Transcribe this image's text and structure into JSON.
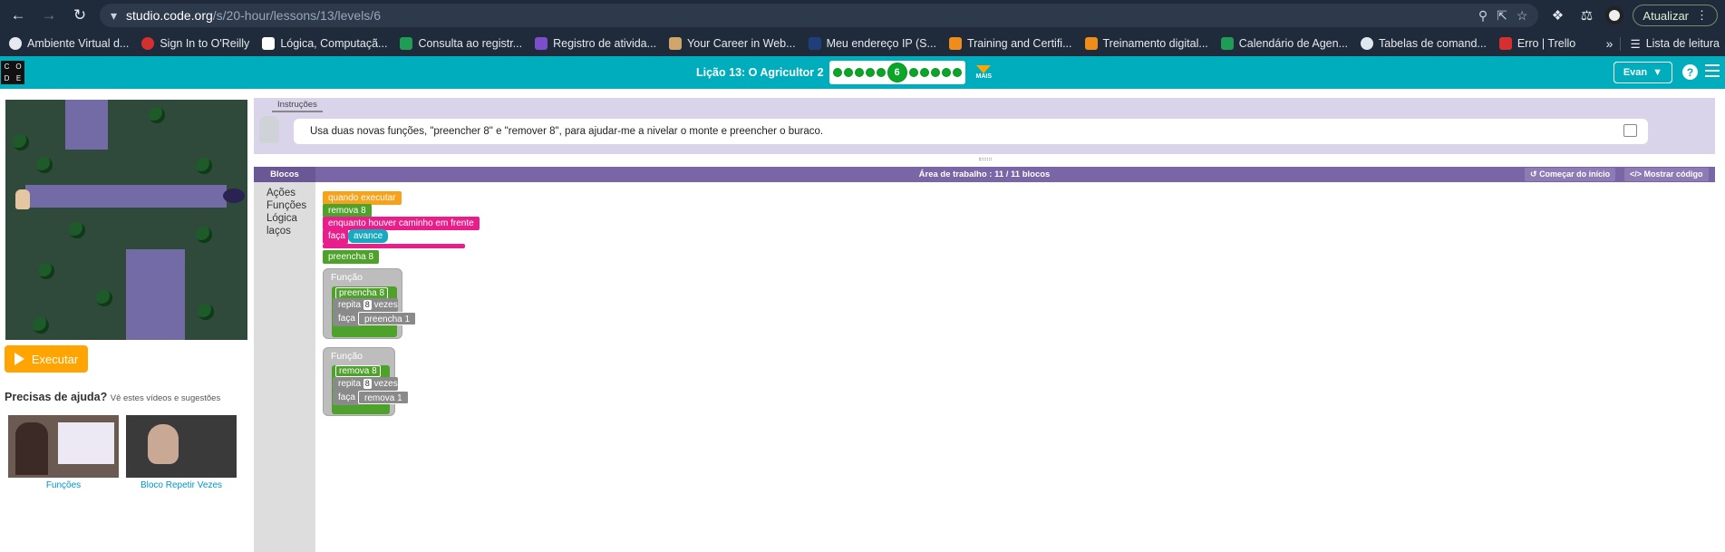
{
  "browser": {
    "url_host": "studio.code.org",
    "url_path": "/s/20-hour/lessons/13/levels/6",
    "update_label": "Atualizar",
    "bookmarks": [
      {
        "label": "Ambiente Virtual d...",
        "color": "#e6e9ef"
      },
      {
        "label": "Sign In to O'Reilly",
        "color": "#d3302f"
      },
      {
        "label": "Lógica, Computaçã...",
        "color": "#ffffff"
      },
      {
        "label": "Consulta ao registr...",
        "color": "#1f9d55"
      },
      {
        "label": "Registro de ativida...",
        "color": "#7b4fc9"
      },
      {
        "label": "Your Career in Web...",
        "color": "#cfa56a"
      },
      {
        "label": "Meu endereço IP (S...",
        "color": "#1f3f7a"
      },
      {
        "label": "Training and Certifi...",
        "color": "#f08c1a"
      },
      {
        "label": "Treinamento digital...",
        "color": "#f08c1a"
      },
      {
        "label": "Calendário de Agen...",
        "color": "#1f9d55"
      },
      {
        "label": "Tabelas de comand...",
        "color": "#dfe6ee"
      },
      {
        "label": "Erro | Trello",
        "color": "#d3302f"
      }
    ],
    "more": "»",
    "reading_list": "Lista de leitura"
  },
  "header": {
    "lesson_title": "Lição 13: O Agricultor 2",
    "current_level": "6",
    "more_label": "MAIS",
    "user_name": "Evan",
    "help": "?"
  },
  "left": {
    "run_label": "Executar",
    "help_heading": "Precisas de ajuda?",
    "help_sub": "Vê estes vídeos e sugestões",
    "videos": [
      {
        "caption": "Funções"
      },
      {
        "caption": "Bloco Repetir Vezes"
      }
    ]
  },
  "instructions": {
    "tab": "Instruções",
    "text": "Usa duas novas funções, \"preencher 8\" e \"remover 8\", para ajudar-me a nivelar o monte e preencher o buraco."
  },
  "workspace": {
    "blocks_tab": "Blocos",
    "title": "Área de trabalho : 11 / 11 blocos",
    "reset_label": "Começar do início",
    "code_label": "Mostrar código",
    "toolbox": [
      "Ações",
      "Funções",
      "Lógica",
      "laços"
    ]
  },
  "program": {
    "when_run": "quando executar",
    "remove8": "remova 8",
    "while_path": "enquanto houver caminho em frente",
    "do": "faça",
    "move": "avance",
    "fill8": "preencha 8",
    "function_label": "Função",
    "repeat": "repita",
    "times": "vezes",
    "count": "8",
    "fill1": "preencha 1",
    "remove1": "remova 1"
  }
}
